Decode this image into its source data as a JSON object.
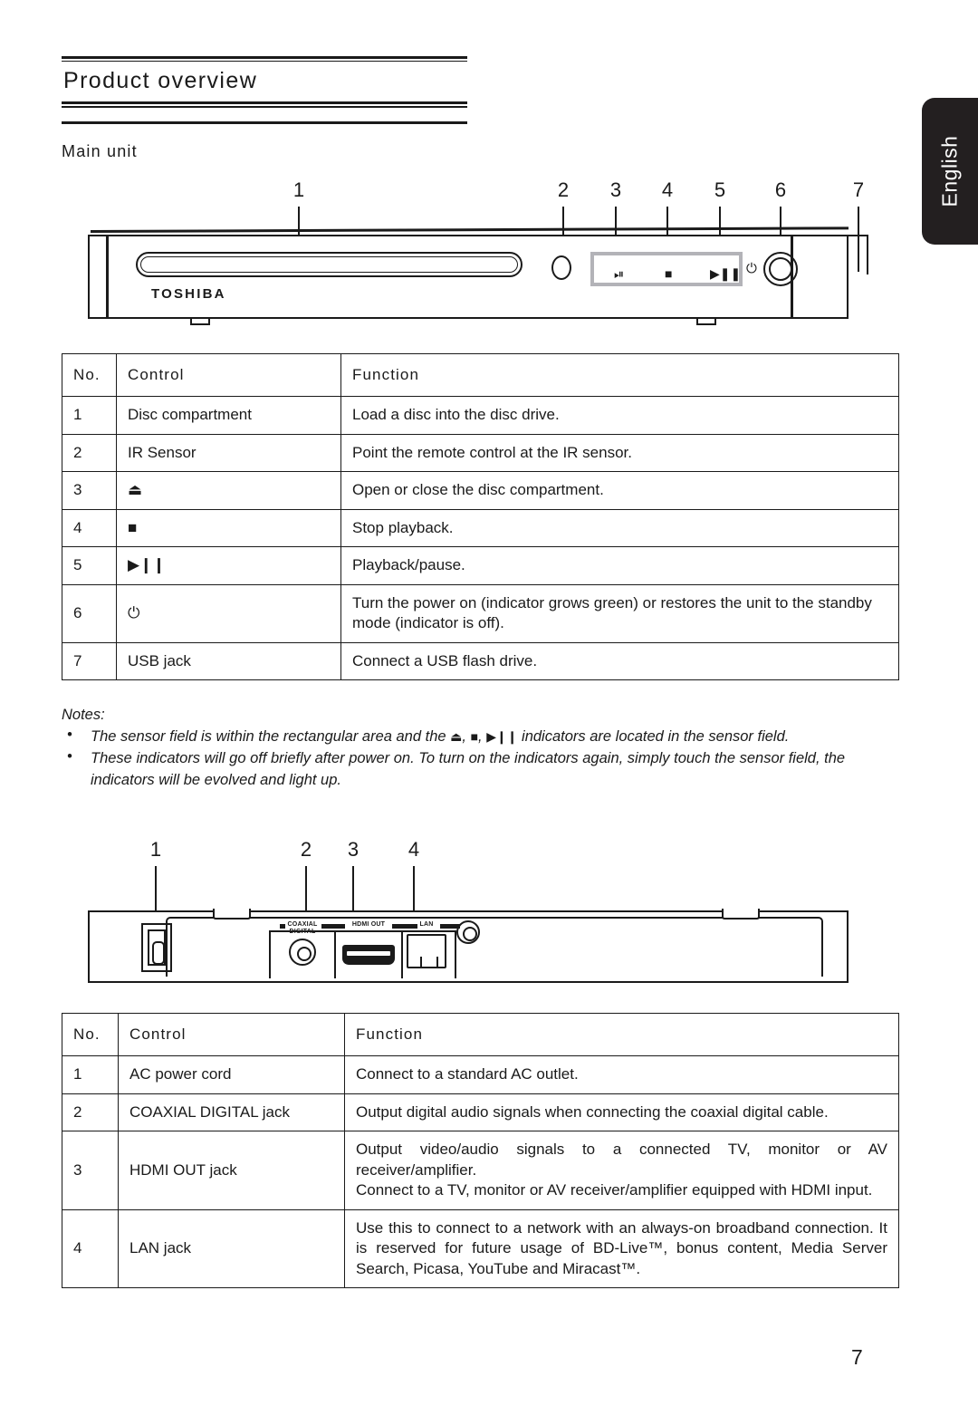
{
  "language_tab": {
    "label": "English"
  },
  "heading": {
    "title": "Product overview"
  },
  "subheading": {
    "label": "Main unit"
  },
  "front_panel": {
    "brand_logo": "TOSHIBA",
    "callouts": [
      "1",
      "2",
      "3",
      "4",
      "5",
      "6",
      "7"
    ],
    "sensor_icons": [
      "eject-icon",
      "stop-icon",
      "play-pause-icon"
    ],
    "power_icon": "power-icon"
  },
  "table_front": {
    "headers": [
      "No.",
      "Control",
      "Function"
    ],
    "rows": [
      {
        "no": "1",
        "control": "Disc compartment",
        "control_icon": "",
        "function": "Load a disc into the disc drive."
      },
      {
        "no": "2",
        "control": "IR Sensor",
        "control_icon": "",
        "function": "Point the remote control at the IR sensor."
      },
      {
        "no": "3",
        "control": "⏏",
        "control_icon": "eject-icon",
        "function": "Open or close the disc compartment."
      },
      {
        "no": "4",
        "control": "■",
        "control_icon": "stop-icon",
        "function": "Stop playback."
      },
      {
        "no": "5",
        "control": "▶❙❙",
        "control_icon": "play-pause-icon",
        "function": "Playback/pause."
      },
      {
        "no": "6",
        "control": "⏻",
        "control_icon": "power-icon",
        "function": "Turn the power on (indicator grows green) or restores the unit to the standby mode (indicator is off)."
      },
      {
        "no": "7",
        "control": "USB jack",
        "control_icon": "",
        "function": "Connect a USB flash drive."
      }
    ]
  },
  "notes": {
    "title": "Notes:",
    "bullet": "•",
    "items": [
      {
        "pre": "The sensor field is within the rectangular area and the ",
        "icon1": "⏏",
        "sep1": ", ",
        "icon2": "■",
        "sep2": ", ",
        "icon3": "▶❙❙",
        "post": " indicators are located in the sensor field."
      },
      {
        "pre": "These indicators will go off briefly after power on. To turn on the indicators again, simply touch the sensor field, the indicators will be evolved and light up.",
        "icon1": "",
        "sep1": "",
        "icon2": "",
        "sep2": "",
        "icon3": "",
        "post": ""
      }
    ]
  },
  "rear_panel": {
    "callouts": [
      "1",
      "2",
      "3",
      "4"
    ],
    "port_labels": {
      "coaxial": "COAXIAL\nDIGITAL",
      "hdmi": "HDMI OUT",
      "lan": "LAN"
    }
  },
  "table_rear": {
    "headers": [
      "No.",
      "Control",
      "Function"
    ],
    "rows": [
      {
        "no": "1",
        "control": "AC power cord",
        "function": "Connect to a standard AC outlet."
      },
      {
        "no": "2",
        "control": "COAXIAL DIGITAL jack",
        "function": "Output digital audio signals when connecting the coaxial digital cable."
      },
      {
        "no": "3",
        "control": "HDMI OUT jack",
        "function": "Output video/audio signals to a connected TV, monitor or AV receiver/amplifier.\nConnect to a TV, monitor or AV receiver/amplifier equipped with HDMI input."
      },
      {
        "no": "4",
        "control": "LAN jack",
        "function": "Use this to connect to a network with an always-on broadband connection. It is reserved for future usage of BD-Live™, bonus content, Media Server Search, Picasa, YouTube and Miracast™."
      }
    ]
  },
  "footer": {
    "page_number": "7"
  },
  "colors": {
    "ink": "#1a1a1a",
    "tab_bg": "#231f20",
    "sensor_field_border": "#b3b3b8"
  }
}
